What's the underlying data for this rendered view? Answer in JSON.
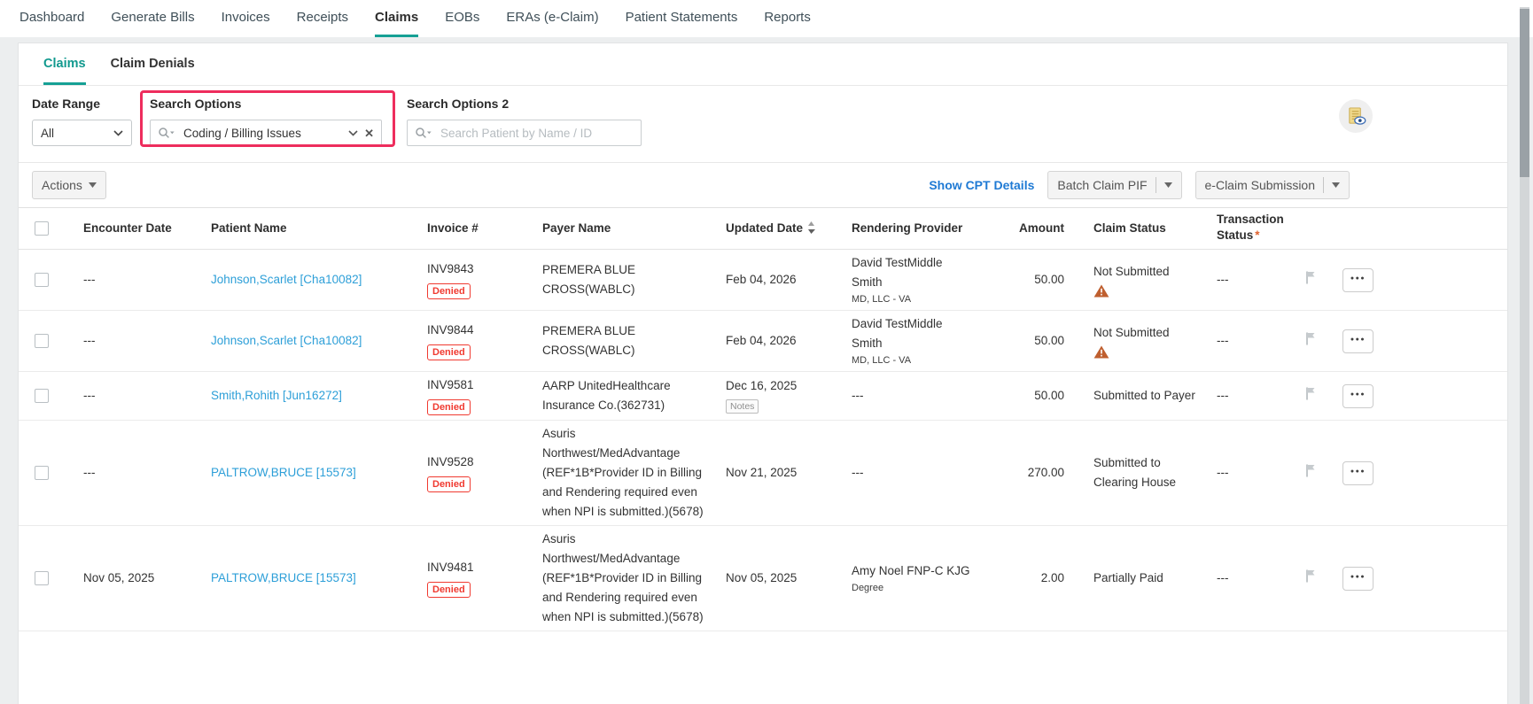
{
  "nav": {
    "items": [
      {
        "label": "Dashboard"
      },
      {
        "label": "Generate Bills"
      },
      {
        "label": "Invoices"
      },
      {
        "label": "Receipts"
      },
      {
        "label": "Claims"
      },
      {
        "label": "EOBs"
      },
      {
        "label": "ERAs (e-Claim)"
      },
      {
        "label": "Patient Statements"
      },
      {
        "label": "Reports"
      }
    ],
    "active": "Claims"
  },
  "tabs": {
    "items": [
      {
        "label": "Claims"
      },
      {
        "label": "Claim Denials"
      }
    ],
    "active": "Claims"
  },
  "filters": {
    "date_range": {
      "label": "Date Range",
      "value": "All"
    },
    "search_options": {
      "label": "Search Options",
      "value": "Coding / Billing Issues",
      "clear_glyph": "✕"
    },
    "search_options_2": {
      "label": "Search Options 2",
      "placeholder": "Search Patient by Name / ID"
    }
  },
  "toolbar": {
    "actions": "Actions",
    "show_cpt_details": "Show CPT Details",
    "batch_claim_pif": "Batch Claim PIF",
    "eclaim_submission": "e-Claim Submission"
  },
  "table": {
    "headers": [
      "Encounter Date",
      "Patient Name",
      "Invoice #",
      "Payer Name",
      "Updated Date",
      "Rendering Provider",
      "Amount",
      "Claim Status",
      "Transaction Status"
    ],
    "required_marker": "*",
    "menu_glyph": "●●●",
    "rows": [
      {
        "encounter_date": "---",
        "patient": "Johnson,Scarlet [Cha10082]",
        "invoice": "INV9843",
        "invoice_badge": "Denied",
        "payer": "PREMERA BLUE CROSS(WABLC)",
        "updated_date": "Feb 04, 2026",
        "updated_badge": null,
        "provider": "David TestMiddle Smith",
        "provider_sub": "MD, LLC - VA",
        "amount": "50.00",
        "claim_status": "Not Submitted",
        "claim_warning": true,
        "transaction_status": "---"
      },
      {
        "encounter_date": "---",
        "patient": "Johnson,Scarlet [Cha10082]",
        "invoice": "INV9844",
        "invoice_badge": "Denied",
        "payer": "PREMERA BLUE CROSS(WABLC)",
        "updated_date": "Feb 04, 2026",
        "updated_badge": null,
        "provider": "David TestMiddle Smith",
        "provider_sub": "MD, LLC - VA",
        "amount": "50.00",
        "claim_status": "Not Submitted",
        "claim_warning": true,
        "transaction_status": "---"
      },
      {
        "encounter_date": "---",
        "patient": "Smith,Rohith [Jun16272]",
        "invoice": "INV9581",
        "invoice_badge": "Denied",
        "payer": "AARP UnitedHealthcare Insurance Co.(362731)",
        "updated_date": "Dec 16, 2025",
        "updated_badge": "Notes",
        "provider": "---",
        "provider_sub": null,
        "amount": "50.00",
        "claim_status": "Submitted to Payer",
        "claim_warning": false,
        "transaction_status": "---"
      },
      {
        "encounter_date": "---",
        "patient": "PALTROW,BRUCE [15573]",
        "invoice": "INV9528",
        "invoice_badge": "Denied",
        "payer": "Asuris Northwest/MedAdvantage (REF*1B*Provider ID in Billing and Rendering required even when NPI is submitted.)(5678)",
        "updated_date": "Nov 21, 2025",
        "updated_badge": null,
        "provider": "---",
        "provider_sub": null,
        "amount": "270.00",
        "claim_status": "Submitted to Clearing House",
        "claim_warning": false,
        "transaction_status": "---"
      },
      {
        "encounter_date": "Nov 05, 2025",
        "patient": "PALTROW,BRUCE [15573]",
        "invoice": "INV9481",
        "invoice_badge": "Denied",
        "payer": "Asuris Northwest/MedAdvantage (REF*1B*Provider ID in Billing and Rendering required even when NPI is submitted.)(5678)",
        "updated_date": "Nov 05, 2025",
        "updated_badge": null,
        "provider": "Amy Noel FNP-C KJG",
        "provider_sub": "Degree",
        "amount": "2.00",
        "claim_status": "Partially Paid",
        "claim_warning": false,
        "transaction_status": "---"
      }
    ]
  },
  "colors": {
    "accent_teal": "#16a095",
    "patient_link_blue": "#2d9fd8",
    "action_link_blue": "#1f7ad4",
    "denied_red": "#f03a30",
    "notes_gray": "#8f8f8f",
    "warning_orange": "#bf5f2f",
    "highlight_pink": "#ee2d5d",
    "required_orange": "#e0622e"
  }
}
